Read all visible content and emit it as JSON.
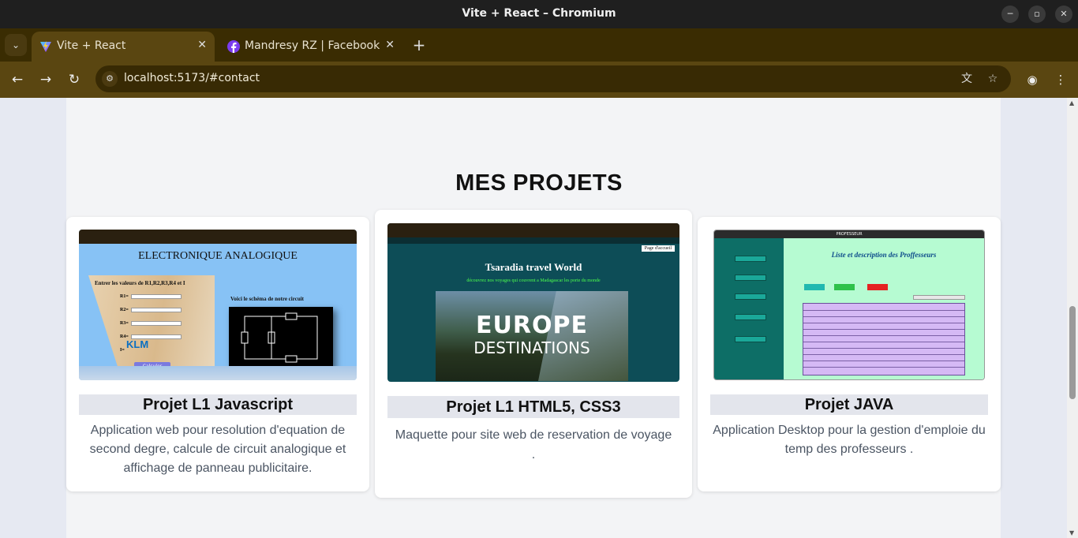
{
  "window": {
    "title": "Vite + React – Chromium",
    "minimize_glyph": "─",
    "maximize_glyph": "▫",
    "close_glyph": "✕"
  },
  "tabs": [
    {
      "label": "Vite + React",
      "icon": "vite-logo-icon",
      "active": true,
      "close_glyph": "✕"
    },
    {
      "label": "Mandresy RZ | Facebook",
      "icon": "facebook-logo-icon",
      "active": false,
      "close_glyph": "✕"
    }
  ],
  "tabstrip": {
    "menu_glyph": "⌄",
    "new_tab_glyph": "+"
  },
  "toolbar": {
    "back_glyph": "←",
    "forward_glyph": "→",
    "reload_glyph": "↻",
    "url": "localhost:5173/#contact",
    "site_info_glyph": "⚙",
    "translate_glyph": "文",
    "bookmark_glyph": "☆",
    "profile_glyph": "◉",
    "menu_glyph": "⋮"
  },
  "page": {
    "section_title": "MES PROJETS"
  },
  "projects": [
    {
      "title": "Projet L1 Javascript",
      "description": "Application web pour resolution d'equation de second degre, calcule de circuit analogique et affichage de panneau publicitaire.",
      "thumbnail": {
        "heading": "ELECTRONIQUE ANALOGIQUE",
        "form_prompt": "Entrer les valeurs de R1,R2,R3,R4 et I",
        "fields": [
          "R1=",
          "R2=",
          "R3=",
          "R4=",
          "I="
        ],
        "button": "Calculer",
        "logo": "KLM",
        "schema_label": "Voici le schéma de notre circuit"
      }
    },
    {
      "title": "Projet L1 HTML5, CSS3",
      "description": "Maquette pour site web de reservation de voyage .",
      "thumbnail": {
        "nav_link": "Page d'accueil",
        "heading": "Tsaradia travel World",
        "subheading": "découvrez nos voyages qui couvrent a Madagascar les porte du monde",
        "banner_big": "EUROPE",
        "banner_small": "DESTINATIONS"
      }
    },
    {
      "title": "Projet JAVA",
      "description": "Application Desktop pour la gestion d'emploie du temp des professeurs .",
      "thumbnail": {
        "window_title": "PROFESSEUR",
        "heading": "Liste et description des Proffesseurs",
        "menu_items": [
          "Proffesseur",
          "Salle",
          "Classe",
          "Emploie Temp",
          "Deconnexion"
        ]
      }
    }
  ],
  "colors": {
    "titlebar": "#1f1f1f",
    "tabstrip": "#3a2c02",
    "toolbar": "#5a4611",
    "page_bg": "#e6e9f2",
    "panel_bg": "#f3f4f6",
    "card_label_bg": "#e3e5ec"
  }
}
